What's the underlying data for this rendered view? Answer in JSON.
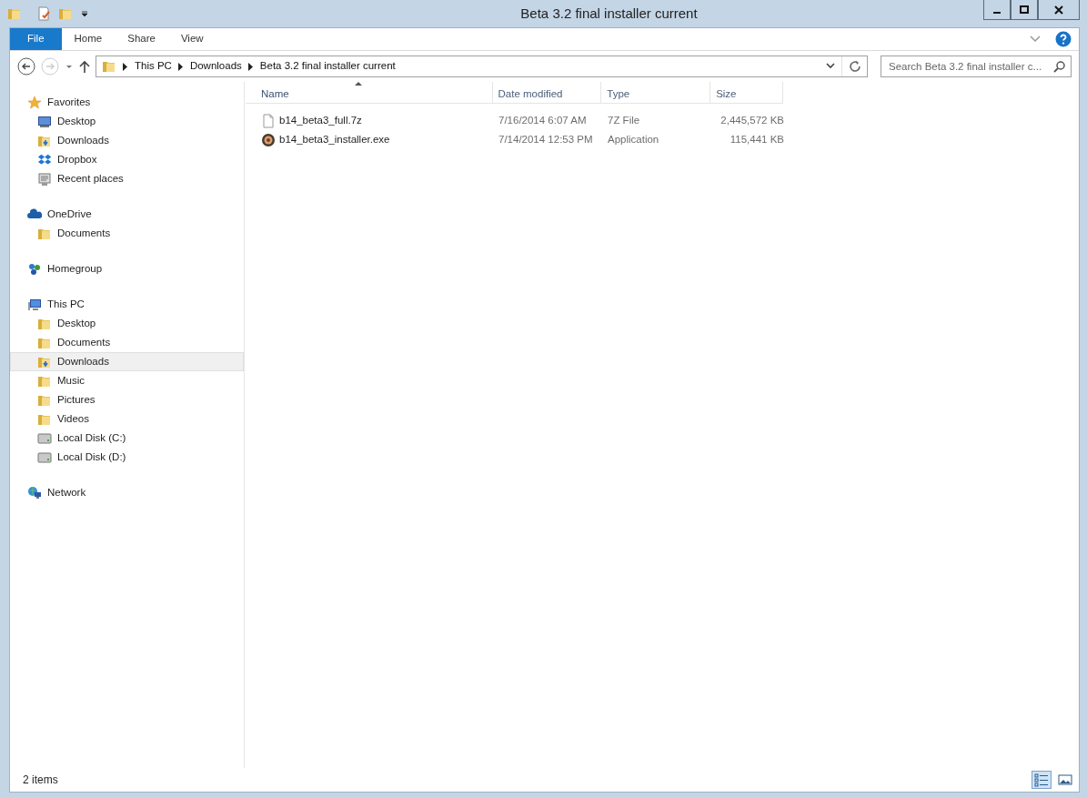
{
  "window": {
    "title": "Beta 3.2 final installer current"
  },
  "ribbon": {
    "tabs": [
      {
        "label": "File",
        "kind": "file",
        "selected": false
      },
      {
        "label": "Home",
        "kind": "tab",
        "selected": false
      },
      {
        "label": "Share",
        "kind": "tab",
        "selected": false
      },
      {
        "label": "View",
        "kind": "tab",
        "selected": false
      }
    ]
  },
  "address_bar": {
    "path": [
      "This PC",
      "Downloads",
      "Beta 3.2 final installer current"
    ]
  },
  "search": {
    "placeholder": "Search Beta 3.2 final installer c..."
  },
  "sidebar": {
    "groups": [
      {
        "label": "Favorites",
        "selected": false,
        "children": [
          {
            "label": "Desktop",
            "selected": false
          },
          {
            "label": "Downloads",
            "selected": false
          },
          {
            "label": "Dropbox",
            "selected": false
          },
          {
            "label": "Recent places",
            "selected": false
          }
        ]
      },
      {
        "label": "OneDrive",
        "selected": false,
        "children": [
          {
            "label": "Documents",
            "selected": false
          }
        ]
      },
      {
        "label": "Homegroup",
        "selected": false
      },
      {
        "label": "This PC",
        "selected": false,
        "children": [
          {
            "label": "Desktop",
            "selected": false
          },
          {
            "label": "Documents",
            "selected": false
          },
          {
            "label": "Downloads",
            "selected": true
          },
          {
            "label": "Music",
            "selected": false
          },
          {
            "label": "Pictures",
            "selected": false
          },
          {
            "label": "Videos",
            "selected": false
          },
          {
            "label": "Local Disk (C:)",
            "selected": false
          },
          {
            "label": "Local Disk (D:)",
            "selected": false
          }
        ]
      },
      {
        "label": "Network",
        "selected": false
      }
    ]
  },
  "table": {
    "columns": [
      {
        "label": "Name",
        "sorted": true
      },
      {
        "label": "Date modified",
        "sorted": false
      },
      {
        "label": "Type",
        "sorted": false
      },
      {
        "label": "Size",
        "sorted": false
      }
    ],
    "rows": [
      {
        "name": "b14_beta3_full.7z",
        "date": "7/16/2014 6:07 AM",
        "type": "7Z File",
        "size": "2,445,572 KB"
      },
      {
        "name": "b14_beta3_installer.exe",
        "date": "7/14/2014 12:53 PM",
        "type": "Application",
        "size": "115,441 KB"
      }
    ]
  },
  "status_bar": {
    "text": "2 items",
    "views": [
      {
        "kind": "details",
        "selected": true
      },
      {
        "kind": "large-icons",
        "selected": false
      }
    ]
  }
}
